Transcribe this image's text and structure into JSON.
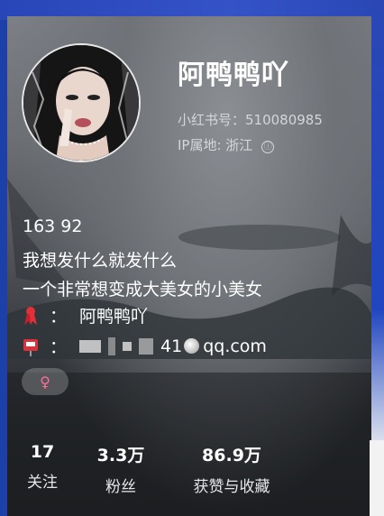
{
  "profile": {
    "nickname": "阿鸭鸭吖",
    "red_id": "小红书号：510080985",
    "ip_location": "IP属地: 浙江",
    "info_icon_glyph": "ⓘ"
  },
  "bio": {
    "line1": "163 92",
    "line2": "我想发什么就发什么",
    "line3": "一个非常想变成大美女的小美女"
  },
  "details": {
    "name_colon": "：",
    "name_value": "阿鸭鸭吖",
    "email_colon": "：",
    "email_visible_part": "41",
    "email_domain": "qq.com"
  },
  "gender": {
    "symbol": "♀",
    "color": "#ff6f9a"
  },
  "stats": [
    {
      "value": "17",
      "label": "关注"
    },
    {
      "value": "3.3万",
      "label": "粉丝"
    },
    {
      "value": "86.9万",
      "label": "获赞与收藏"
    }
  ],
  "colors": {
    "background_blue": "#1c3fa8",
    "text_white": "#ffffff",
    "meta_gray": "#d4d6d9"
  }
}
